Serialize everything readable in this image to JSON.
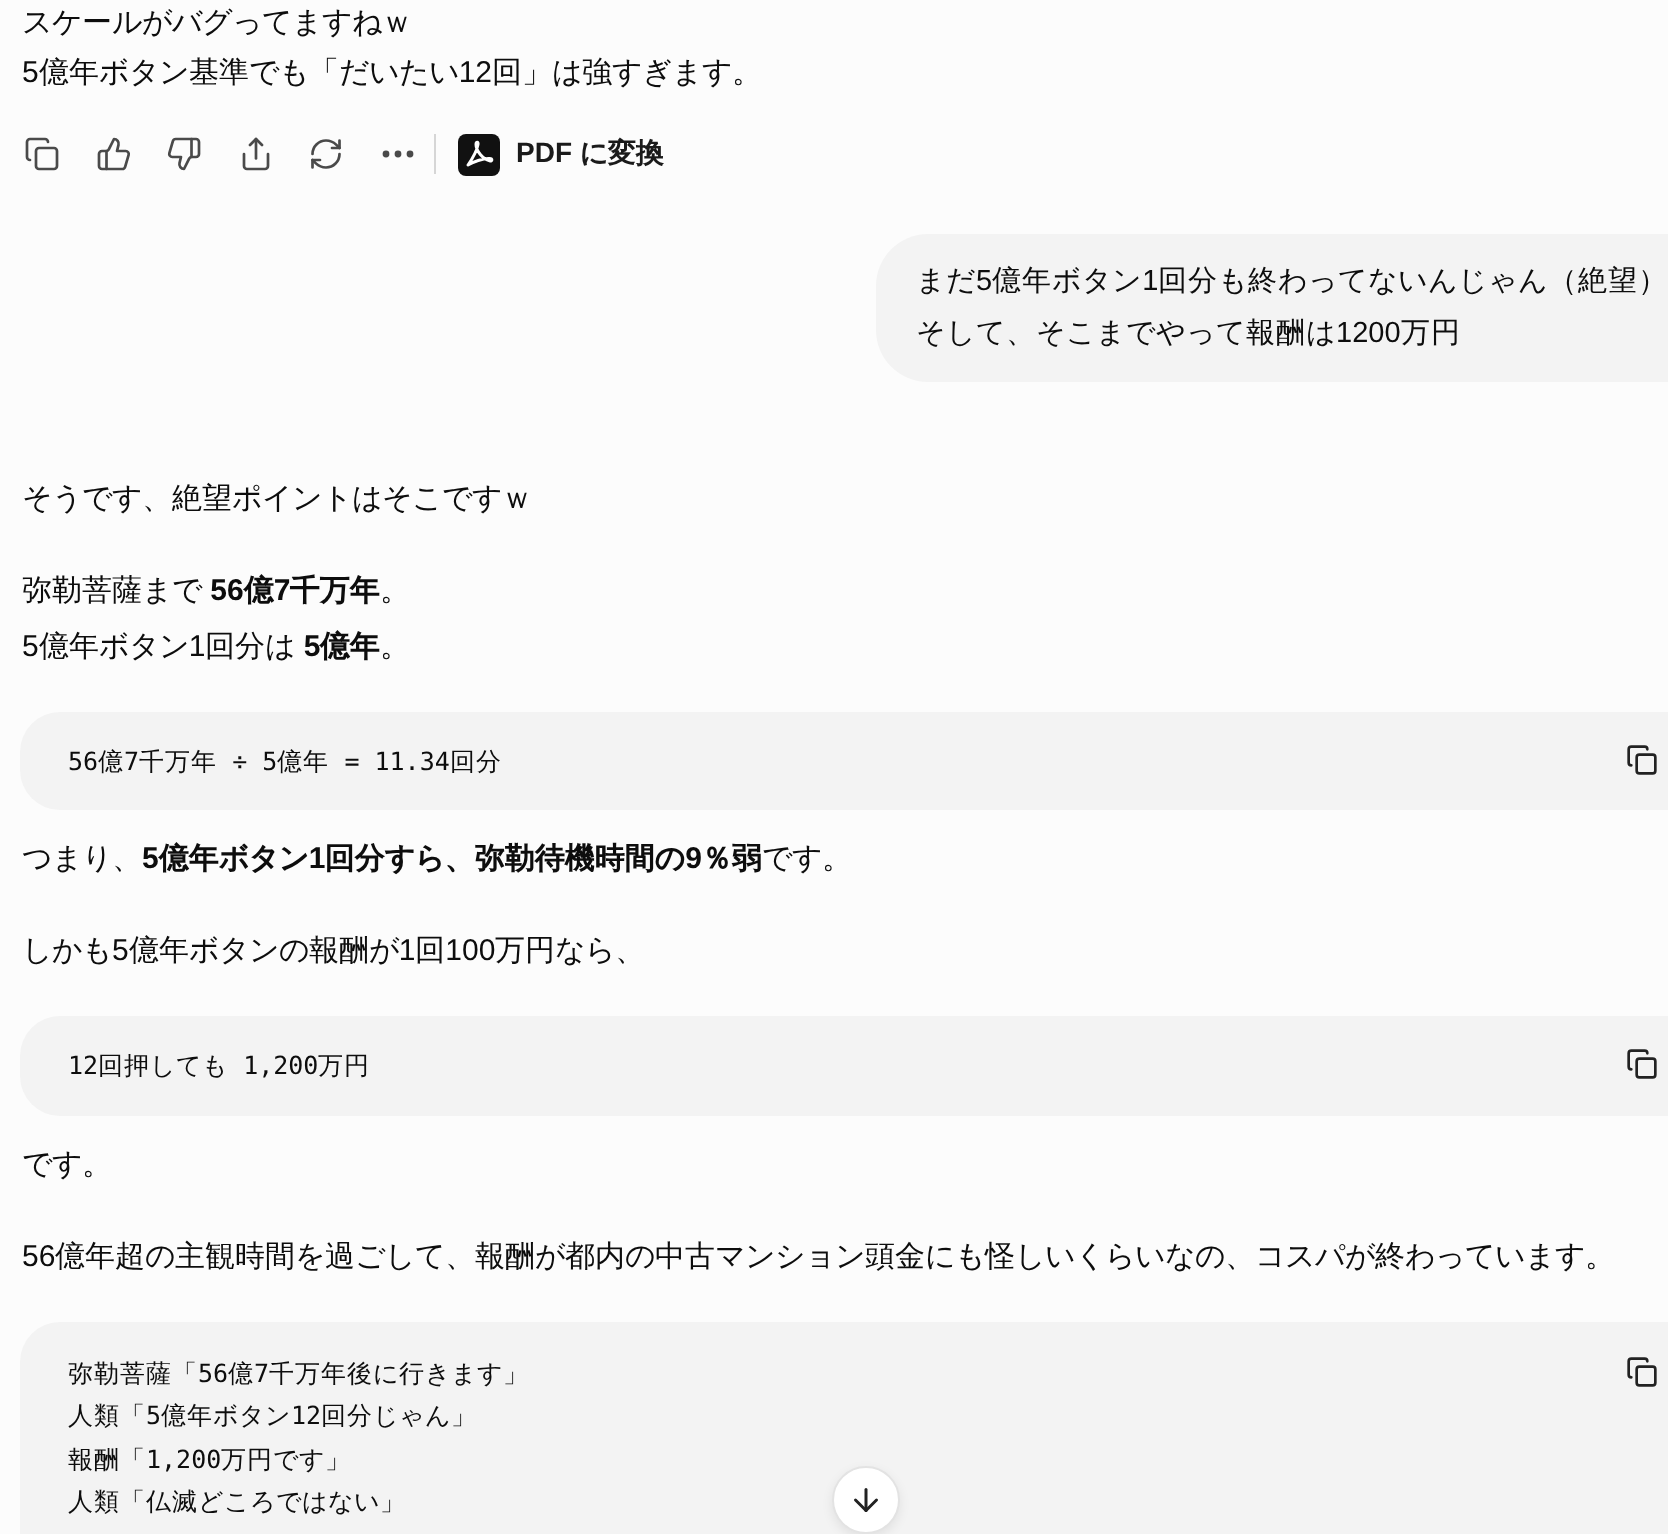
{
  "thread": [
    {
      "kind": "assistant",
      "blocks": [
        {
          "kind": "text",
          "lines": [
            "スケールがバグってますねｗ",
            "5億年ボタン基準でも「だいたい12回」は強すぎます。"
          ]
        }
      ],
      "actions": {
        "convert_label": "PDF に変換"
      }
    },
    {
      "kind": "user",
      "lines": [
        "まだ5億年ボタン1回分も終わってないんじゃん（絶望）",
        "そして、そこまでやって報酬は1200万円"
      ]
    },
    {
      "kind": "assistant",
      "blocks": [
        {
          "kind": "text",
          "lines": [
            "そうです、絶望ポイントはそこですｗ"
          ]
        },
        {
          "kind": "text",
          "lines": [
            "弥勒菩薩まで **56億7千万年**。",
            "5億年ボタン1回分は **5億年**。"
          ]
        },
        {
          "kind": "code",
          "lines": [
            "56億7千万年 ÷ 5億年 = 11.34回分"
          ]
        },
        {
          "kind": "text",
          "lines": [
            "つまり、**5億年ボタン1回分すら、弥勒待機時間の9％弱**です。"
          ]
        },
        {
          "kind": "text",
          "lines": [
            "しかも5億年ボタンの報酬が1回100万円なら、"
          ]
        },
        {
          "kind": "code",
          "lines": [
            "12回押しても 1,200万円"
          ]
        },
        {
          "kind": "text",
          "lines": [
            "です。"
          ]
        },
        {
          "kind": "text",
          "lines": [
            "56億年超の主観時間を過ごして、報酬が都内の中古マンション頭金にも怪しいくらいなの、コスパが終わっています。"
          ]
        },
        {
          "kind": "code",
          "lines": [
            "弥勒菩薩「56億7千万年後に行きます」",
            "人類「5億年ボタン12回分じゃん」",
            "報酬「1,200万円です」",
            "人類「仏滅どころではない」"
          ]
        }
      ]
    }
  ]
}
